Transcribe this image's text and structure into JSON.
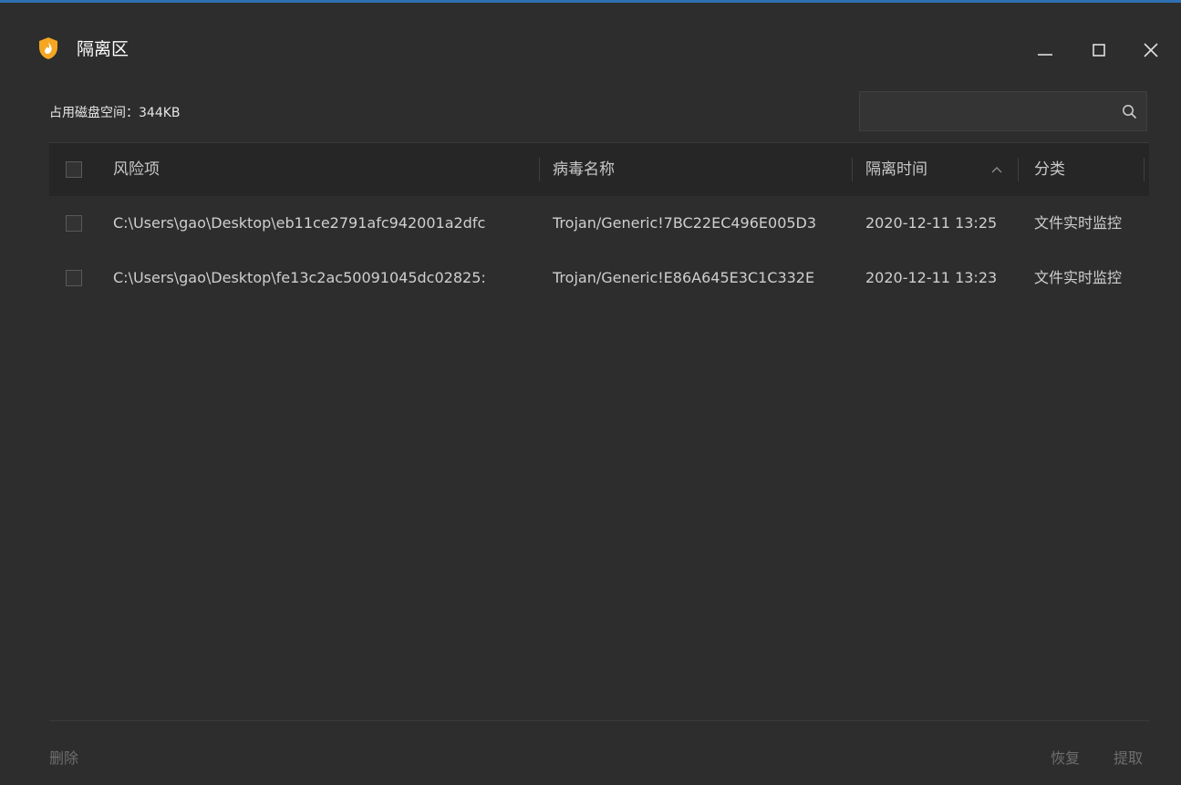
{
  "window": {
    "title": "隔离区",
    "brand_color": "#f5a623",
    "accent_color": "#2f6fb3",
    "controls": {
      "minimize": "minimize-icon",
      "maximize": "maximize-icon",
      "close": "close-icon"
    }
  },
  "disk_usage": "占用磁盘空间：344KB",
  "search": {
    "placeholder": "",
    "value": "",
    "icon": "search-icon"
  },
  "table": {
    "columns": {
      "risk_item": "风险项",
      "virus_name": "病毒名称",
      "quarantine_time": "隔离时间",
      "category": "分类"
    },
    "sort": {
      "column": "quarantine_time",
      "icon": "sort-up-icon"
    },
    "rows": [
      {
        "risk_item": "C:\\Users\\gao\\Desktop\\eb11ce2791afc942001a2dfc",
        "virus_name": "Trojan/Generic!7BC22EC496E005D3",
        "quarantine_time": "2020-12-11 13:25",
        "category": "文件实时监控"
      },
      {
        "risk_item": "C:\\Users\\gao\\Desktop\\fe13c2ac50091045dc02825:",
        "virus_name": "Trojan/Generic!E86A645E3C1C332E",
        "quarantine_time": "2020-12-11 13:23",
        "category": "文件实时监控"
      }
    ]
  },
  "footer": {
    "delete_label": "删除",
    "restore_label": "恢复",
    "extract_label": "提取"
  }
}
